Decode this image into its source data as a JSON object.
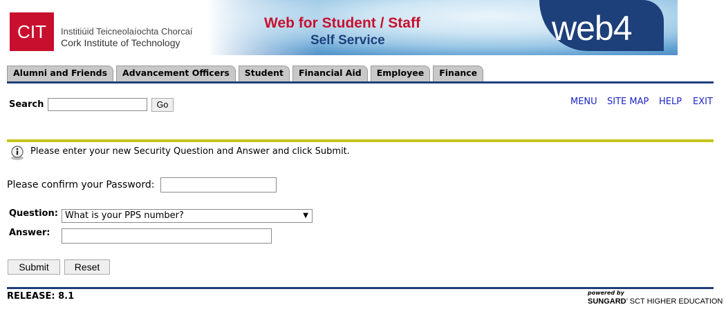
{
  "banner": {
    "cit_short": "CIT",
    "cit_name_irish": "Institiúid Teicneolaíochta Chorcaí",
    "cit_name_english": "Cork Institute of Technology",
    "title_line1": "Web for Student / Staff",
    "title_line2": "Self Service",
    "product": "web4"
  },
  "tabs": [
    "Alumni and Friends",
    "Advancement Officers",
    "Student",
    "Financial Aid",
    "Employee",
    "Finance"
  ],
  "search": {
    "label": "Search",
    "value": "",
    "go_label": "Go"
  },
  "toplinks": {
    "menu": "MENU",
    "site_map": "SITE MAP",
    "help": "HELP",
    "exit": "EXIT"
  },
  "info": {
    "icon": "info-icon",
    "message": "Please enter your new Security Question and Answer and click Submit."
  },
  "form": {
    "password_label": "Please confirm your Password:",
    "question_label": "Question:",
    "question_selected": "What is your PPS number?",
    "answer_label": "Answer:",
    "submit_label": "Submit",
    "reset_label": "Reset"
  },
  "footer": {
    "release": "RELEASE: 8.1",
    "powered_by": "powered by",
    "vendor_name": "SUNGARD",
    "vendor_tail": "SCT HIGHER EDUCATION"
  },
  "colors": {
    "navy": "#1d3f7a",
    "cit_red": "#c8102e",
    "yellow_rule": "#c5c51a",
    "link_blue": "#1a24c4"
  }
}
